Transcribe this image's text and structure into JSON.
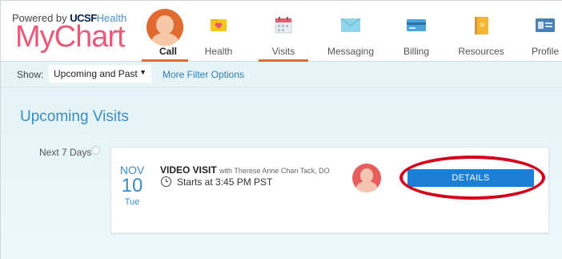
{
  "brand": {
    "powered_by": "Powered by",
    "org_mark": "UCSF",
    "org_health": "Health",
    "app_name_my": "My",
    "app_name_chart": "Chart",
    "accent_color": "#e06a2f"
  },
  "nav": {
    "items": [
      {
        "label": "Call",
        "icon": "call-avatar",
        "active": true
      },
      {
        "label": "Health",
        "icon": "heart-folder-icon",
        "active": false
      },
      {
        "label": "Visits",
        "icon": "calendar-icon",
        "active": true
      },
      {
        "label": "Messaging",
        "icon": "envelope-icon",
        "active": false
      },
      {
        "label": "Billing",
        "icon": "credit-card-icon",
        "active": false
      },
      {
        "label": "Resources",
        "icon": "book-icon",
        "active": false
      },
      {
        "label": "Profile",
        "icon": "id-card-icon",
        "active": false
      }
    ]
  },
  "filter": {
    "show_label": "Show:",
    "selected": "Upcoming and Past",
    "more_options": "More Filter Options"
  },
  "main": {
    "section_title": "Upcoming Visits",
    "range_label": "Next 7 Days"
  },
  "visit": {
    "month": "NOV",
    "day": "10",
    "weekday": "Tue",
    "type": "VIDEO VISIT",
    "with_prefix": "with",
    "provider": "Therese Anne Chan Tack, DO",
    "start_time": "Starts at 3:45 PM PST",
    "details_label": "DETAILS",
    "button_color": "#1b7fd6",
    "highlight_color": "#d4001a"
  }
}
